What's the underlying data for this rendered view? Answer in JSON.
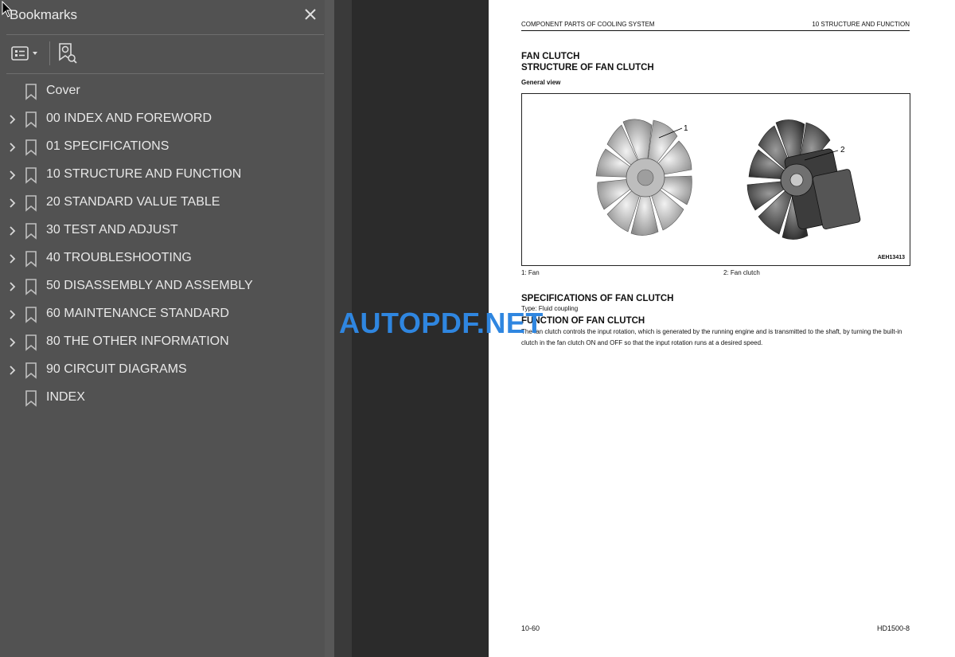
{
  "sidebar": {
    "title": "Bookmarks",
    "items": [
      {
        "label": "Cover",
        "expandable": false
      },
      {
        "label": "00 INDEX AND FOREWORD",
        "expandable": true
      },
      {
        "label": "01 SPECIFICATIONS",
        "expandable": true
      },
      {
        "label": "10 STRUCTURE AND FUNCTION",
        "expandable": true
      },
      {
        "label": "20 STANDARD VALUE TABLE",
        "expandable": true
      },
      {
        "label": "30 TEST AND ADJUST",
        "expandable": true
      },
      {
        "label": "40 TROUBLESHOOTING",
        "expandable": true
      },
      {
        "label": "50 DISASSEMBLY AND ASSEMBLY",
        "expandable": true
      },
      {
        "label": "60 MAINTENANCE STANDARD",
        "expandable": true
      },
      {
        "label": "80 THE OTHER INFORMATION",
        "expandable": true
      },
      {
        "label": "90 CIRCUIT DIAGRAMS",
        "expandable": true
      },
      {
        "label": "INDEX",
        "expandable": false
      }
    ]
  },
  "page": {
    "header_left": "COMPONENT PARTS OF COOLING SYSTEM",
    "header_right": "10 STRUCTURE AND FUNCTION",
    "title1": "FAN CLUTCH",
    "title2": "STRUCTURE OF FAN CLUTCH",
    "subtitle": "General view",
    "figure": {
      "callout1": "1",
      "callout2": "2",
      "code": "AEH13413"
    },
    "caption1": "1: Fan",
    "caption2": "2: Fan clutch",
    "spec_heading": "SPECIFICATIONS OF FAN CLUTCH",
    "spec_type": "Type: Fluid coupling",
    "function_heading": "FUNCTION OF FAN CLUTCH",
    "function_text": "The fan clutch controls the input rotation, which is generated by the running engine and is transmitted to the shaft, by turning the built-in clutch in the fan clutch ON and OFF so that the input rotation runs at a desired speed.",
    "page_number": "10-60",
    "model": "HD1500-8"
  },
  "watermark": "AUTOPDF.NET",
  "colors": {
    "sidebar_bg": "#525252",
    "page_bg": "#ffffff",
    "watermark": "#2f86e0"
  }
}
